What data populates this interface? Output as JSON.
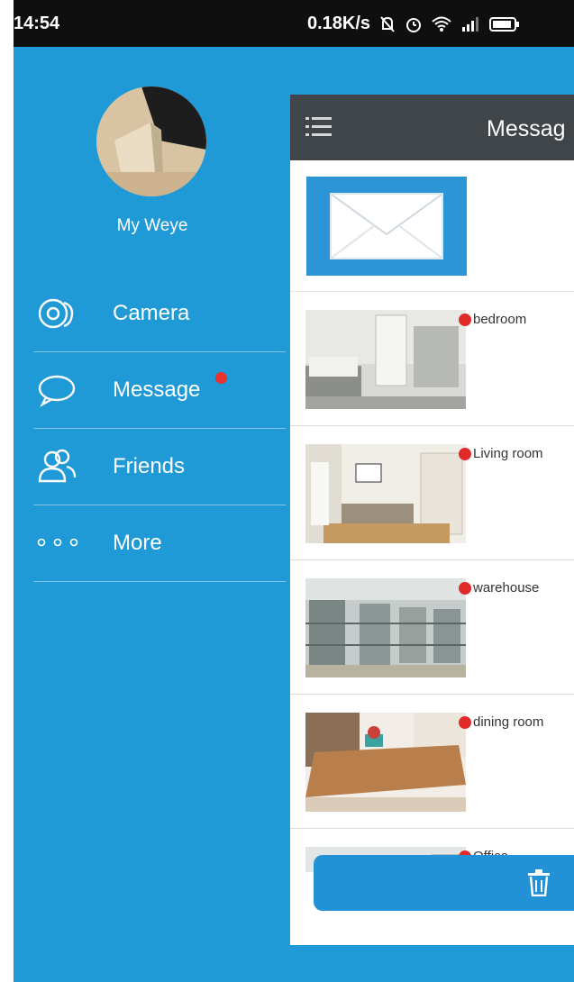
{
  "status_bar": {
    "time": "14:54",
    "net_speed": "0.18K/s",
    "icons": [
      "notification-off-icon",
      "alarm-icon",
      "wifi-icon",
      "signal-icon",
      "battery-icon"
    ]
  },
  "profile": {
    "name": "My Weye"
  },
  "menu": {
    "items": [
      {
        "label": "Camera",
        "icon": "camera-icon",
        "badge": false
      },
      {
        "label": "Message",
        "icon": "chat-bubble-icon",
        "badge": true
      },
      {
        "label": "Friends",
        "icon": "friends-icon",
        "badge": false
      },
      {
        "label": "More",
        "icon": "more-dots-icon",
        "badge": false
      }
    ]
  },
  "panel": {
    "title": "Messag",
    "messages": [
      {
        "name": "bedroom"
      },
      {
        "name": "Living room"
      },
      {
        "name": "warehouse"
      },
      {
        "name": "dining room"
      },
      {
        "name": "Office"
      }
    ]
  },
  "colors": {
    "drawer_bg": "#1f9ad7",
    "header_bg": "#3f4548",
    "badge": "#e12a2a",
    "action_bar": "#2391d6"
  }
}
